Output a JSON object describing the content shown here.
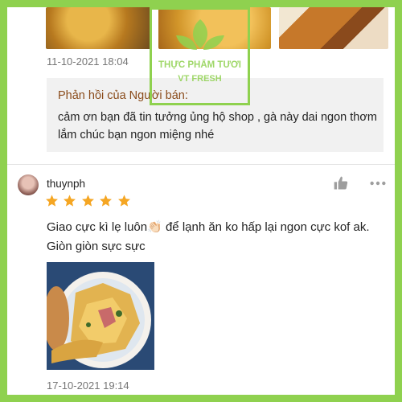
{
  "watermark": {
    "brand_line1": "THỰC PHẨM TƯƠI",
    "brand_line2": "VT FRESH"
  },
  "previous_review": {
    "timestamp": "11-10-2021 18:04"
  },
  "seller_reply": {
    "title": "Phản hồi của Người bán:",
    "text": "cảm ơn bạn đã tin tưởng ủng hộ shop , gà này dai ngon thơm lắm chúc bạn ngon miệng nhé"
  },
  "review": {
    "username": "thuynph",
    "rating": 5,
    "text_part1": "Giao cực kì lẹ luôn",
    "emoji": "👏🏻",
    "text_part2": " để lạnh ăn ko hấp lại ngon cực kof ak. Giòn giòn sực sực",
    "timestamp": "17-10-2021 19:14"
  },
  "icons": {
    "like": "thumbs-up-icon",
    "more": "more-options-icon",
    "star": "star-icon"
  },
  "colors": {
    "frame": "#8fd14f",
    "star": "#f5a623",
    "seller_title": "#8a4b1a"
  }
}
